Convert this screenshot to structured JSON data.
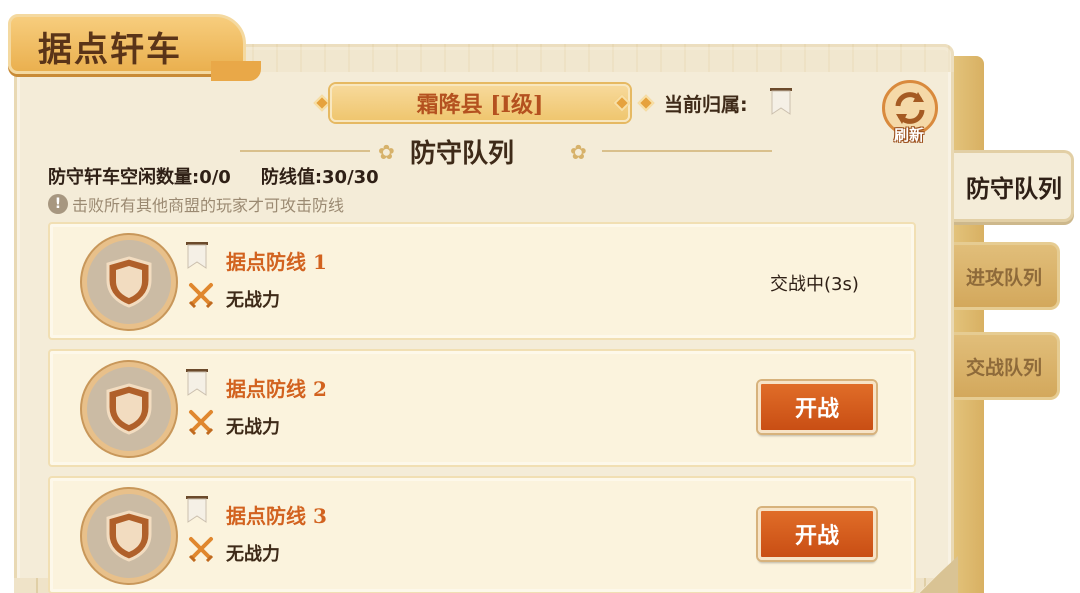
{
  "title": "据点轩车",
  "county": {
    "name": "霜降县 [I级]"
  },
  "owner_label": "当前归属:",
  "refresh_label": "刷新",
  "section_title": "防守队列",
  "stats": {
    "idle_label": "防守轩车空闲数量:0/0",
    "defense_value": "防线值:30/30"
  },
  "hint": "击败所有其他商盟的玩家才可攻击防线",
  "hint_icon": "!",
  "rows": [
    {
      "name": "据点防线 1",
      "power": "无战力",
      "status": "交战中(3s)",
      "button": ""
    },
    {
      "name": "据点防线 2",
      "power": "无战力",
      "status": "",
      "button": "开战"
    },
    {
      "name": "据点防线 3",
      "power": "无战力",
      "status": "",
      "button": "开战"
    }
  ],
  "tabs": [
    {
      "label": "防守队列",
      "active": true
    },
    {
      "label": "进攻队列",
      "active": false
    },
    {
      "label": "交战队列",
      "active": false
    }
  ],
  "colors": {
    "accent_orange": "#d2621f",
    "button_orange": "#c94e14",
    "paper": "#f4ecd8"
  },
  "icons": {
    "shield": "shield-icon",
    "crossed_swords": "crossed-swords-icon",
    "pennant": "pennant-icon",
    "refresh": "refresh-icon"
  }
}
